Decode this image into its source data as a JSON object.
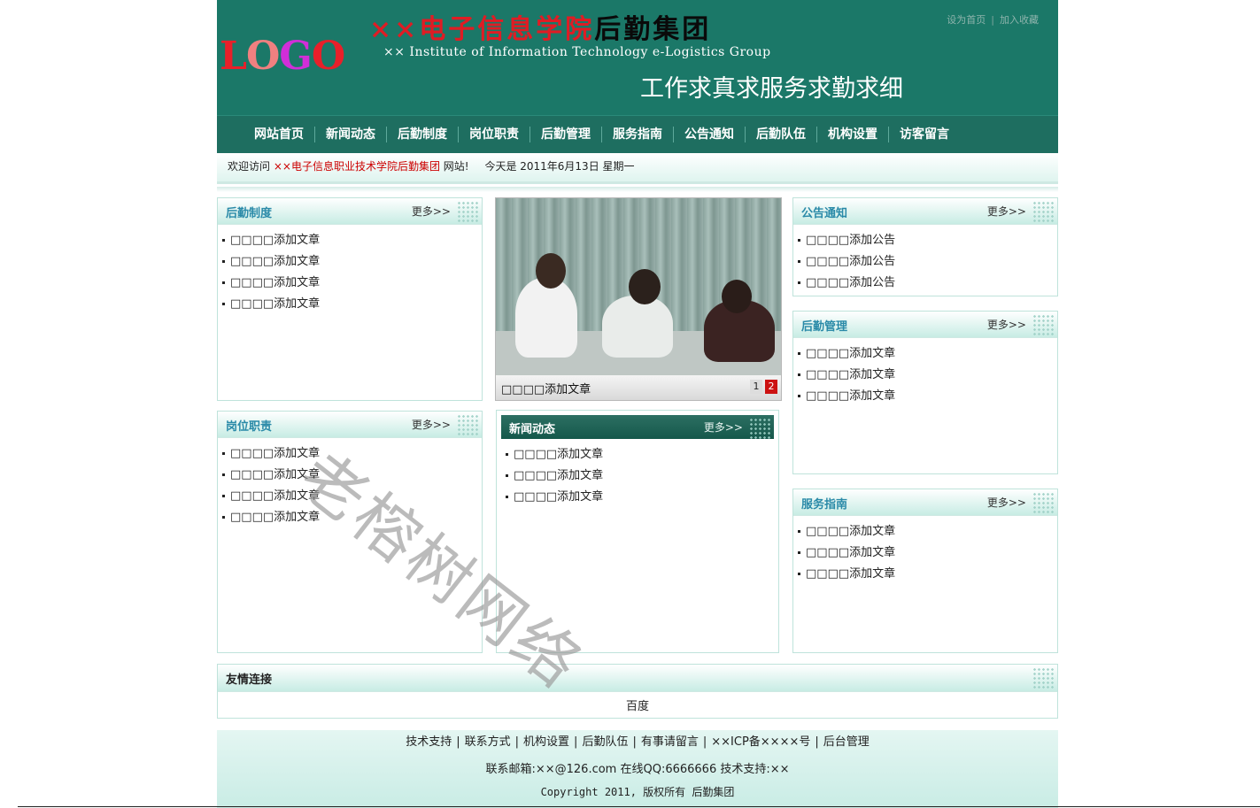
{
  "header": {
    "logo_letters": [
      "L",
      "O",
      "G",
      "O"
    ],
    "title_red": "××电子信息学院",
    "title_black": "后勤集团",
    "subtitle": "×× Institute of Information Technology e-Logistics Group",
    "slogan": "工作求真求服务求勤求细",
    "top_links": [
      "设为首页",
      "加入收藏"
    ],
    "colors": {
      "header_bg": "#1b7868",
      "title_red": "#e01c24"
    }
  },
  "nav": {
    "items": [
      "网站首页",
      "新闻动态",
      "后勤制度",
      "岗位职责",
      "后勤管理",
      "服务指南",
      "公告通知",
      "后勤队伍",
      "机构设置",
      "访客留言"
    ]
  },
  "welcome": {
    "prefix": "欢迎访问",
    "school": "××电子信息职业技术学院后勤集团",
    "suffix": "网站!",
    "date": "今天是 2011年6月13日 星期一"
  },
  "more_label": "更多>>",
  "boxes": {
    "houqin_zhidu": {
      "title": "后勤制度",
      "items": [
        "□□□□添加文章",
        "□□□□添加文章",
        "□□□□添加文章",
        "□□□□添加文章"
      ]
    },
    "gangwei_zhize": {
      "title": "岗位职责",
      "items": [
        "□□□□添加文章",
        "□□□□添加文章",
        "□□□□添加文章",
        "□□□□添加文章"
      ]
    },
    "xinwen": {
      "title": "新闻动态",
      "items": [
        "□□□□添加文章",
        "□□□□添加文章",
        "□□□□添加文章"
      ]
    },
    "gonggao": {
      "title": "公告通知",
      "items": [
        "□□□□添加公告",
        "□□□□添加公告",
        "□□□□添加公告"
      ]
    },
    "guanli": {
      "title": "后勤管理",
      "items": [
        "□□□□添加文章",
        "□□□□添加文章",
        "□□□□添加文章"
      ]
    },
    "fuwu": {
      "title": "服务指南",
      "items": [
        "□□□□添加文章",
        "□□□□添加文章",
        "□□□□添加文章"
      ]
    }
  },
  "slideshow": {
    "caption": "□□□□添加文章",
    "pages": [
      "1",
      "2"
    ],
    "active_page": "2"
  },
  "friend_links": {
    "title": "友情连接",
    "links": [
      "百度"
    ]
  },
  "footer": {
    "links": [
      "技术支持",
      "联系方式",
      "机构设置",
      "后勤队伍",
      "有事请留言",
      "××ICP备××××号",
      "后台管理"
    ],
    "contact": "联系邮箱:××@126.com 在线QQ:6666666 技术支持:××",
    "copyright": "Copyright 2011, 版权所有 后勤集团"
  },
  "watermark": "老榕树网络"
}
